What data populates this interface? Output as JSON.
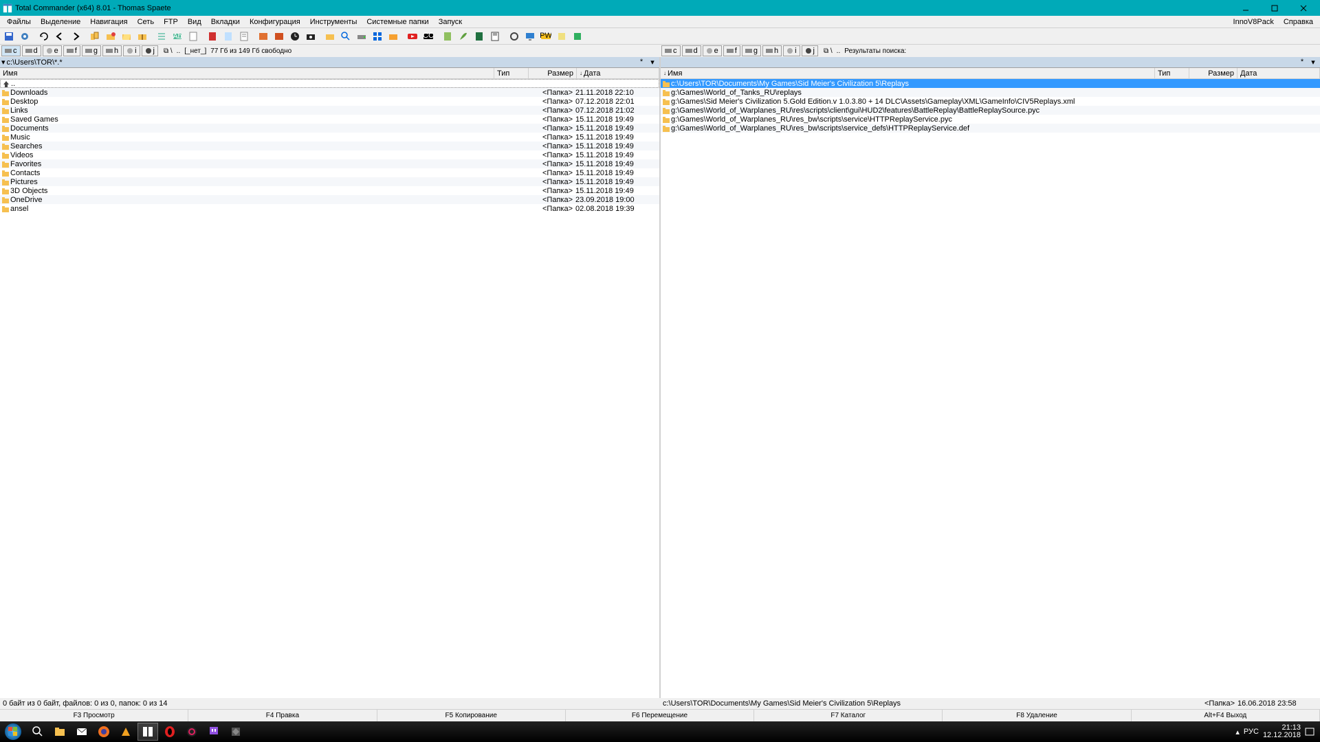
{
  "title": "Total Commander (x64) 8.01 - Thomas Spaete",
  "menu": {
    "items": [
      "Файлы",
      "Выделение",
      "Навигация",
      "Сеть",
      "FTP",
      "Вид",
      "Вкладки",
      "Конфигурация",
      "Инструменты",
      "Системные папки",
      "Запуск"
    ],
    "right": [
      "InnoV8Pack",
      "Справка"
    ]
  },
  "drives": {
    "list": [
      "c",
      "d",
      "e",
      "f",
      "g",
      "h",
      "i",
      "j"
    ],
    "dots": "..",
    "none": "[_нет_]",
    "left_free": "77 Гб из 149 Гб свободно",
    "right_label": "Результаты поиска:"
  },
  "left": {
    "path": "c:\\Users\\TOR\\*.*",
    "cols": {
      "name": "Имя",
      "ext": "Тип",
      "size": "Размер",
      "date": "Дата"
    },
    "rows": [
      {
        "n": "..",
        "sz": "",
        "dt": ""
      },
      {
        "n": "Downloads",
        "sz": "<Папка>",
        "dt": "21.11.2018 22:10"
      },
      {
        "n": "Desktop",
        "sz": "<Папка>",
        "dt": "07.12.2018 22:01"
      },
      {
        "n": "Links",
        "sz": "<Папка>",
        "dt": "07.12.2018 21:02"
      },
      {
        "n": "Saved Games",
        "sz": "<Папка>",
        "dt": "15.11.2018 19:49"
      },
      {
        "n": "Documents",
        "sz": "<Папка>",
        "dt": "15.11.2018 19:49"
      },
      {
        "n": "Music",
        "sz": "<Папка>",
        "dt": "15.11.2018 19:49"
      },
      {
        "n": "Searches",
        "sz": "<Папка>",
        "dt": "15.11.2018 19:49"
      },
      {
        "n": "Videos",
        "sz": "<Папка>",
        "dt": "15.11.2018 19:49"
      },
      {
        "n": "Favorites",
        "sz": "<Папка>",
        "dt": "15.11.2018 19:49"
      },
      {
        "n": "Contacts",
        "sz": "<Папка>",
        "dt": "15.11.2018 19:49"
      },
      {
        "n": "Pictures",
        "sz": "<Папка>",
        "dt": "15.11.2018 19:49"
      },
      {
        "n": "3D Objects",
        "sz": "<Папка>",
        "dt": "15.11.2018 19:49"
      },
      {
        "n": "OneDrive",
        "sz": "<Папка>",
        "dt": "23.09.2018 19:00"
      },
      {
        "n": "ansel",
        "sz": "<Папка>",
        "dt": "02.08.2018 19:39"
      }
    ],
    "status": "0 байт из 0 байт, файлов: 0 из 0, папок: 0 из 14"
  },
  "right": {
    "path": "",
    "cols": {
      "name": "Имя",
      "ext": "Тип",
      "size": "Размер",
      "date": "Дата"
    },
    "rows": [
      {
        "n": "c:\\Users\\TOR\\Documents\\My Games\\Sid Meier's Civilization 5\\Replays",
        "sel": true
      },
      {
        "n": "g:\\Games\\World_of_Tanks_RU\\replays"
      },
      {
        "n": "g:\\Games\\Sid Meier's Civilization 5.Gold Edition.v 1.0.3.80 + 14 DLC\\Assets\\Gameplay\\XML\\GameInfo\\CIV5Replays.xml"
      },
      {
        "n": "g:\\Games\\World_of_Warplanes_RU\\res\\scripts\\client\\gui\\HUD2\\features\\BattleReplay\\BattleReplaySource.pyc"
      },
      {
        "n": "g:\\Games\\World_of_Warplanes_RU\\res_bw\\scripts\\service\\HTTPReplayService.pyc"
      },
      {
        "n": "g:\\Games\\World_of_Warplanes_RU\\res_bw\\scripts\\service_defs\\HTTPReplayService.def"
      }
    ],
    "status_path": "c:\\Users\\TOR\\Documents\\My Games\\Sid Meier's Civilization 5\\Replays",
    "status_sz": "<Папка>",
    "status_dt": "16.06.2018 23:58"
  },
  "fkeys": [
    "F3 Просмотр",
    "F4 Правка",
    "F5 Копирование",
    "F6 Перемещение",
    "F7 Каталог",
    "F8 Удаление",
    "Alt+F4 Выход"
  ],
  "tray": {
    "lang": "РУС",
    "time": "21:13",
    "date": "12.12.2018"
  },
  "icons": {
    "folder": "#f6c050",
    "file": "#888"
  }
}
